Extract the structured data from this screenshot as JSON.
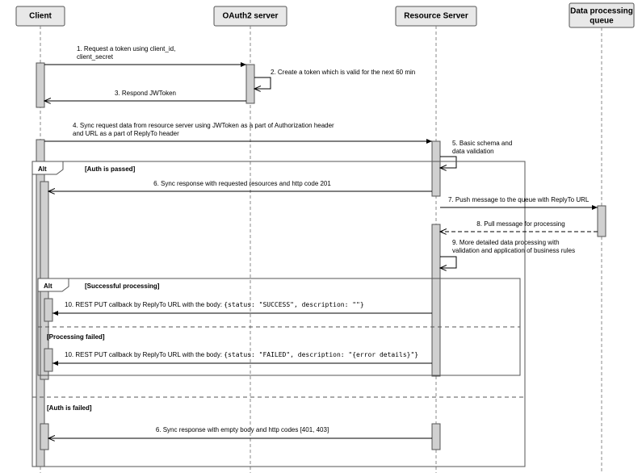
{
  "participants": {
    "p0": "Client",
    "p1": "OAuth2 server",
    "p2": "Resource Server",
    "p3": "Data processing\nqueue"
  },
  "messages": {
    "m1": "1. Request a token using client_id,\nclient_secret",
    "m2": "2. Create a token which is valid for the next 60 min",
    "m3": "3. Respond JWToken",
    "m4": "4. Sync request data from resource server using JWToken as a part of Authorization header\nand URL as a part of ReplyTo header",
    "m5": "5. Basic schema and\ndata validation",
    "m6a": "6. Sync response with requested resources and http code 201",
    "m7": "7. Push message to the queue with ReplyTo URL",
    "m8": "8. Pull message for processing",
    "m9": "9. More detailed data processing with\nvalidation and application of business rules",
    "m10a": "10. REST PUT callback by ReplyTo URL with the body: ",
    "m10a_code": "{status: \"SUCCESS\", description: \"\"}",
    "m10b": "10. REST PUT callback by ReplyTo URL with the body: ",
    "m10b_code": "{status: \"FAILED\", description: \"{error details}\"}",
    "m6b": "6. Sync response with empty body and http codes [401, 403]"
  },
  "fragments": {
    "alt_outer": "Alt",
    "guard_auth_pass": "[Auth is passed]",
    "alt_inner": "Alt",
    "guard_success": "[Successful processing]",
    "guard_fail": "[Processing failed]",
    "guard_auth_fail": "[Auth is failed]"
  }
}
